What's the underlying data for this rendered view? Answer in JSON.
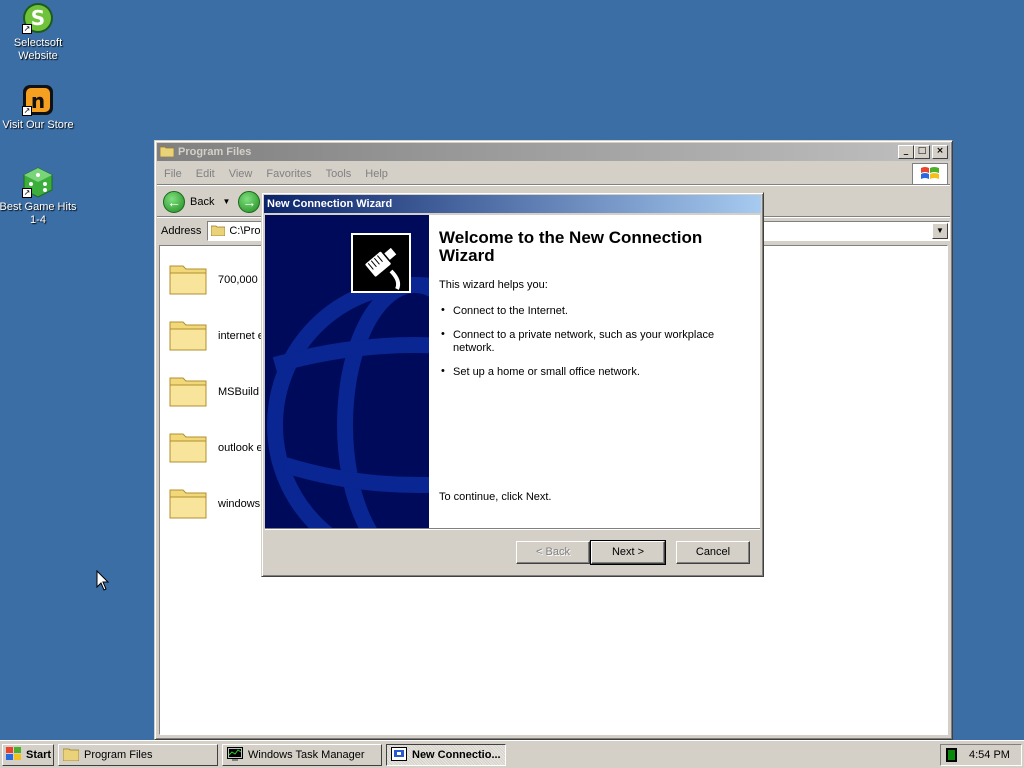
{
  "desktop": {
    "icons": [
      {
        "label": "Selectsoft Website",
        "icon": "selectsoft-s-icon"
      },
      {
        "label": "Visit Our Store",
        "icon": "store-n-icon"
      },
      {
        "label": "Best Game Hits 1-4",
        "icon": "green-dice-icon"
      }
    ]
  },
  "explorer": {
    "title": "Program Files",
    "menu": [
      "File",
      "Edit",
      "View",
      "Favorites",
      "Tools",
      "Help"
    ],
    "back_label": "Back",
    "address_label": "Address",
    "address_value": "C:\\Pro",
    "folders": [
      {
        "name": "700,000"
      },
      {
        "name": "internet e"
      },
      {
        "name": "MSBuild"
      },
      {
        "name": "outlook e"
      },
      {
        "name": "windows"
      }
    ]
  },
  "wizard": {
    "title": "New Connection Wizard",
    "heading": "Welcome to the New Connection Wizard",
    "intro": "This wizard helps you:",
    "bullets": [
      "Connect to the Internet.",
      "Connect to a private network, such as your workplace network.",
      "Set up a home or small office network."
    ],
    "continue_text": "To continue, click Next.",
    "buttons": {
      "back": "< Back",
      "next": "Next >",
      "cancel": "Cancel"
    }
  },
  "taskbar": {
    "start_label": "Start",
    "tasks": [
      {
        "label": "Program Files",
        "icon": "folder-icon",
        "active": false
      },
      {
        "label": "Windows Task Manager",
        "icon": "task-manager-icon",
        "active": false
      },
      {
        "label": "New Connectio...",
        "icon": "network-wizard-icon",
        "active": true
      }
    ],
    "clock": "4:54 PM"
  },
  "colors": {
    "desktop": "#3a6ea5",
    "active_title_start": "#0a246a",
    "active_title_end": "#a6caf0",
    "inactive_title_start": "#808080",
    "wizard_side": "#000a5a"
  }
}
